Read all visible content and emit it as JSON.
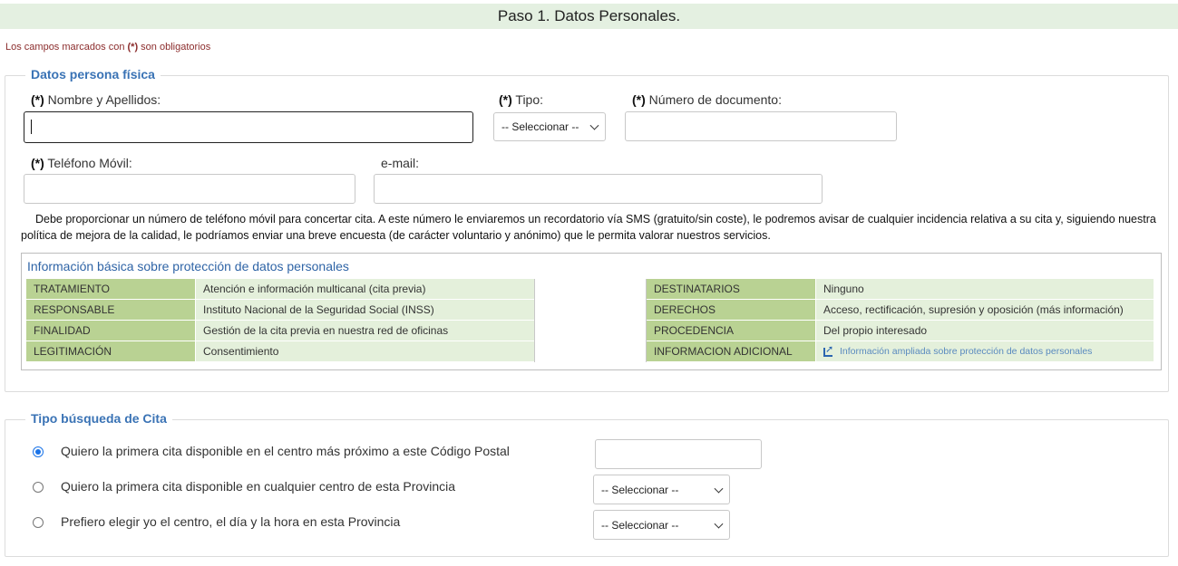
{
  "header": {
    "title": "Paso 1. Datos Personales."
  },
  "required_note": {
    "marker": "(*)",
    "prefix": "Los campos marcados con ",
    "suffix": " son obligatorios"
  },
  "personal": {
    "legend": "Datos persona física",
    "req_marker": "(*)",
    "name_label": " Nombre y Apellidos:",
    "tipo_label": " Tipo:",
    "tipo_selected": "-- Seleccionar --",
    "doc_label": " Número de documento:",
    "phone_label": " Teléfono Móvil:",
    "email_label": "e-mail:",
    "sms_note": "Debe proporcionar un número de teléfono móvil para concertar cita. A este número le enviaremos un recordatorio vía SMS (gratuito/sin coste), le podremos avisar de cualquier incidencia relativa a su cita y, siguiendo nuestra política de mejora de la calidad, le podríamos enviar una breve encuesta (de carácter voluntario y anónimo) que le permita valorar nuestros servicios."
  },
  "privacy": {
    "title": "Información básica sobre protección de datos personales",
    "rows": [
      {
        "k1": "TRATAMIENTO",
        "v1": "Atención e información multicanal (cita previa)",
        "k2": "DESTINATARIOS",
        "v2": "Ninguno"
      },
      {
        "k1": "RESPONSABLE",
        "v1": "Instituto Nacional de la Seguridad Social (INSS)",
        "k2": "DERECHOS",
        "v2": "Acceso, rectificación, supresión y oposición (más información)"
      },
      {
        "k1": "FINALIDAD",
        "v1": "Gestión de la cita previa en nuestra red de oficinas",
        "k2": "PROCEDENCIA",
        "v2": "Del propio interesado"
      },
      {
        "k1": "LEGITIMACIÓN",
        "v1": "Consentimiento",
        "k2": "INFORMACION ADICIONAL",
        "v2": "Información ampliada sobre protección de datos personales"
      }
    ]
  },
  "search": {
    "legend": "Tipo búsqueda de Cita",
    "options": [
      {
        "label": "Quiero la primera cita disponible en el centro más próximo a este Código Postal",
        "checked": true
      },
      {
        "label": "Quiero la primera cita disponible en cualquier centro de esta Provincia",
        "checked": false,
        "select": "-- Seleccionar --"
      },
      {
        "label": "Prefiero elegir yo el centro, el día y la hora en esta Provincia",
        "checked": false,
        "select": "-- Seleccionar --"
      }
    ]
  },
  "colors": {
    "header_bg": "#e4f0e1",
    "legend": "#3a73b5",
    "key_cell": "#b9d293",
    "value_cell": "#e4f0db",
    "radio_checked": "#1a73e8"
  }
}
